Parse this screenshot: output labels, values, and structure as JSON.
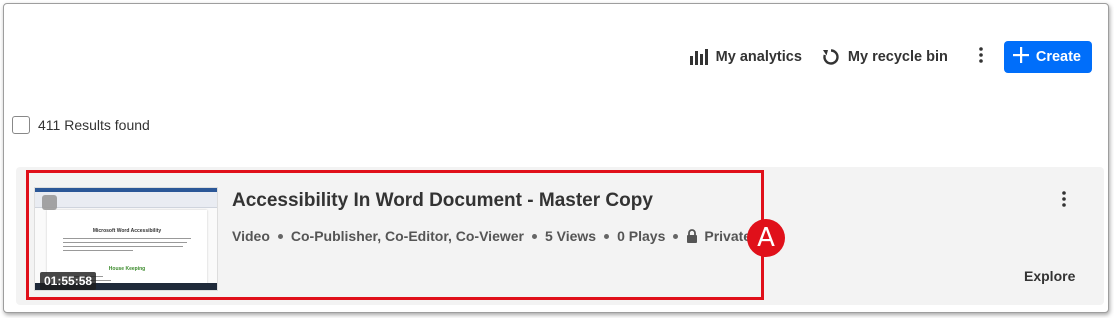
{
  "toolbar": {
    "analytics_label": "My analytics",
    "analytics_icon": "bar-chart-icon",
    "recycle_label": "My recycle bin",
    "recycle_icon": "refresh-icon",
    "more_icon": "vertical-dots-icon",
    "create_label": "Create",
    "create_icon": "plus-icon",
    "create_color": "#006efa"
  },
  "results": {
    "count_text": "411 Results found"
  },
  "entry": {
    "title": "Accessibility In Word Document - Master Copy",
    "duration": "01:55:58",
    "thumbnail": {
      "doc_title": "Microsoft Word Accessibility",
      "section_heading": "House Keeping"
    },
    "meta": {
      "type": "Video",
      "roles": "Co-Publisher, Co-Editor, Co-Viewer",
      "views": "5 Views",
      "plays": "0 Plays",
      "privacy": "Private",
      "privacy_icon": "lock-icon"
    },
    "explore_label": "Explore",
    "more_icon": "vertical-dots-icon"
  },
  "annotation": {
    "label": "A",
    "color": "#e0101a"
  }
}
